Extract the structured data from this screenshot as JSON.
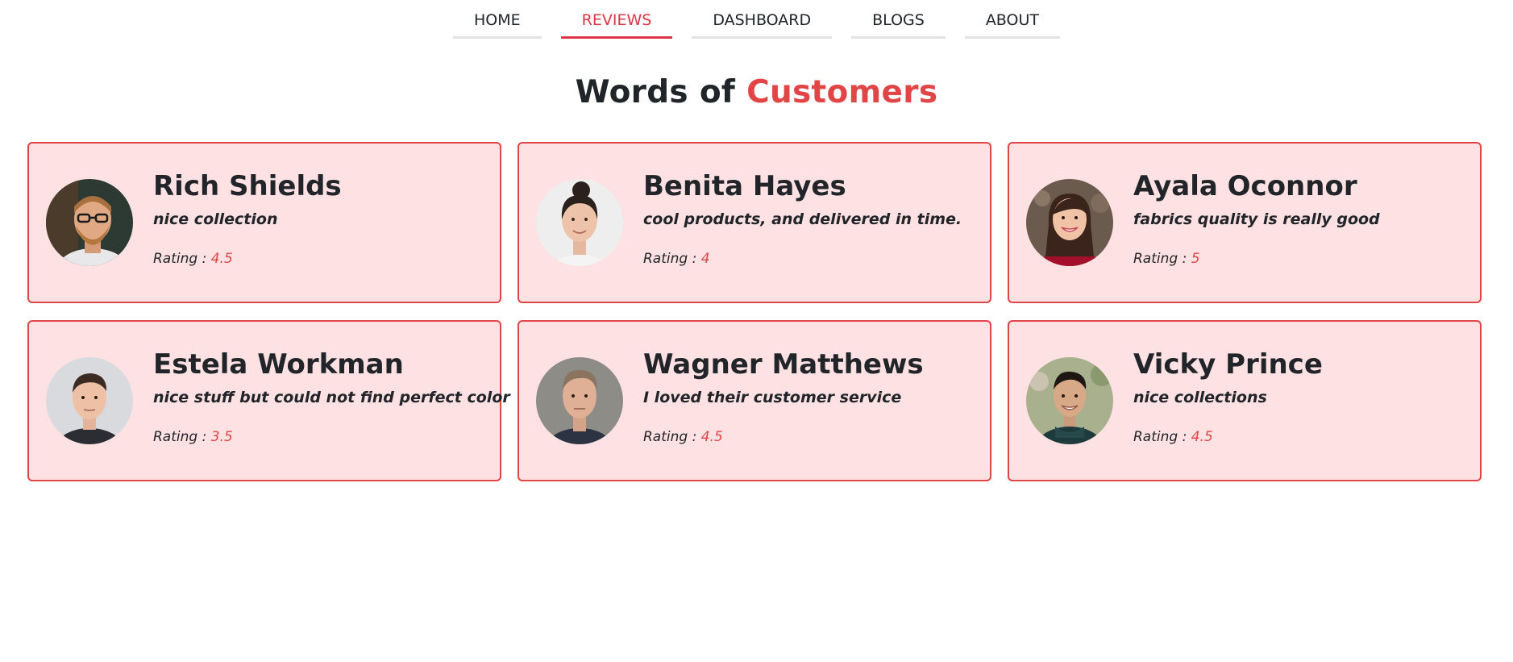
{
  "nav": {
    "items": [
      {
        "label": "HOME",
        "active": false
      },
      {
        "label": "REVIEWS",
        "active": true
      },
      {
        "label": "DASHBOARD",
        "active": false
      },
      {
        "label": "BLOGS",
        "active": false
      },
      {
        "label": "ABOUT",
        "active": false
      }
    ]
  },
  "heading": {
    "prefix": "Words of ",
    "accent": "Customers"
  },
  "rating_label": "Rating : ",
  "colors": {
    "accent": "#e04646",
    "card_bg": "#fde1e3",
    "text": "#212529",
    "nav_underline": "#e3e3e3"
  },
  "reviews": [
    {
      "name": "Rich Shields",
      "comment": "nice collection",
      "rating": "4.5"
    },
    {
      "name": "Benita Hayes",
      "comment": "cool products, and delivered in time.",
      "rating": "4"
    },
    {
      "name": "Ayala Oconnor",
      "comment": "fabrics quality is really good",
      "rating": "5"
    },
    {
      "name": "Estela Workman",
      "comment": "nice stuff but could not find perfect color",
      "rating": "3.5"
    },
    {
      "name": "Wagner Matthews",
      "comment": "I loved their customer service",
      "rating": "4.5"
    },
    {
      "name": "Vicky Prince",
      "comment": "nice collections",
      "rating": "4.5"
    }
  ]
}
